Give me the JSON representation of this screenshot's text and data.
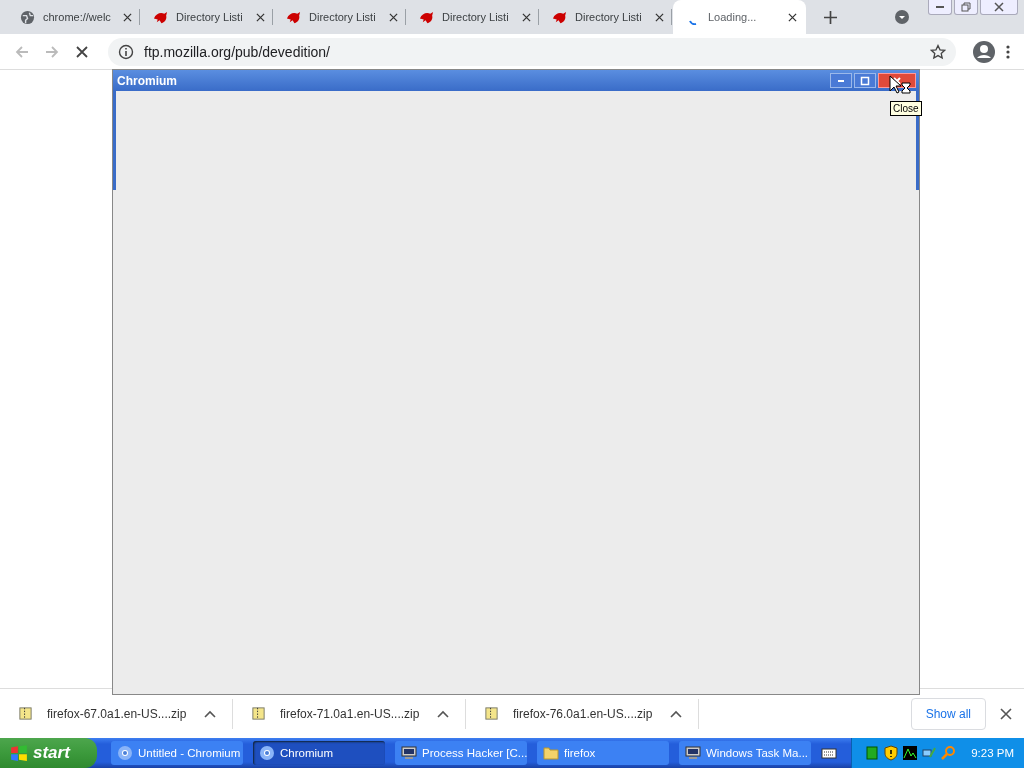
{
  "tabs": [
    {
      "title": "chrome://welc",
      "kind": "globe",
      "selected": false
    },
    {
      "title": "Directory Listi",
      "kind": "dragon",
      "selected": false
    },
    {
      "title": "Directory Listi",
      "kind": "dragon",
      "selected": false
    },
    {
      "title": "Directory Listi",
      "kind": "dragon",
      "selected": false
    },
    {
      "title": "Directory Listi",
      "kind": "dragon",
      "selected": false
    },
    {
      "title": "Loading...",
      "kind": "spinner",
      "selected": true
    }
  ],
  "toolbar": {
    "url": "ftp.mozilla.org/pub/devedition/",
    "loading": true
  },
  "dialog": {
    "title": "Chromium",
    "tooltip": "Close"
  },
  "downloads": {
    "items": [
      "firefox-67.0a1.en-US....zip",
      "firefox-71.0a1.en-US....zip",
      "firefox-76.0a1.en-US....zip"
    ],
    "show_all": "Show all"
  },
  "taskbar": {
    "start": "start",
    "tasks": [
      {
        "label": "Untitled - Chromium",
        "kind": "chrome",
        "selected": false
      },
      {
        "label": "Chromium",
        "kind": "chrome",
        "selected": true
      },
      {
        "label": "Process Hacker [C...",
        "kind": "monitor",
        "selected": false
      },
      {
        "label": "firefox",
        "kind": "folder",
        "selected": false
      },
      {
        "label": "Windows Task Ma...",
        "kind": "monitor",
        "selected": false
      }
    ],
    "clock": "9:23 PM"
  }
}
